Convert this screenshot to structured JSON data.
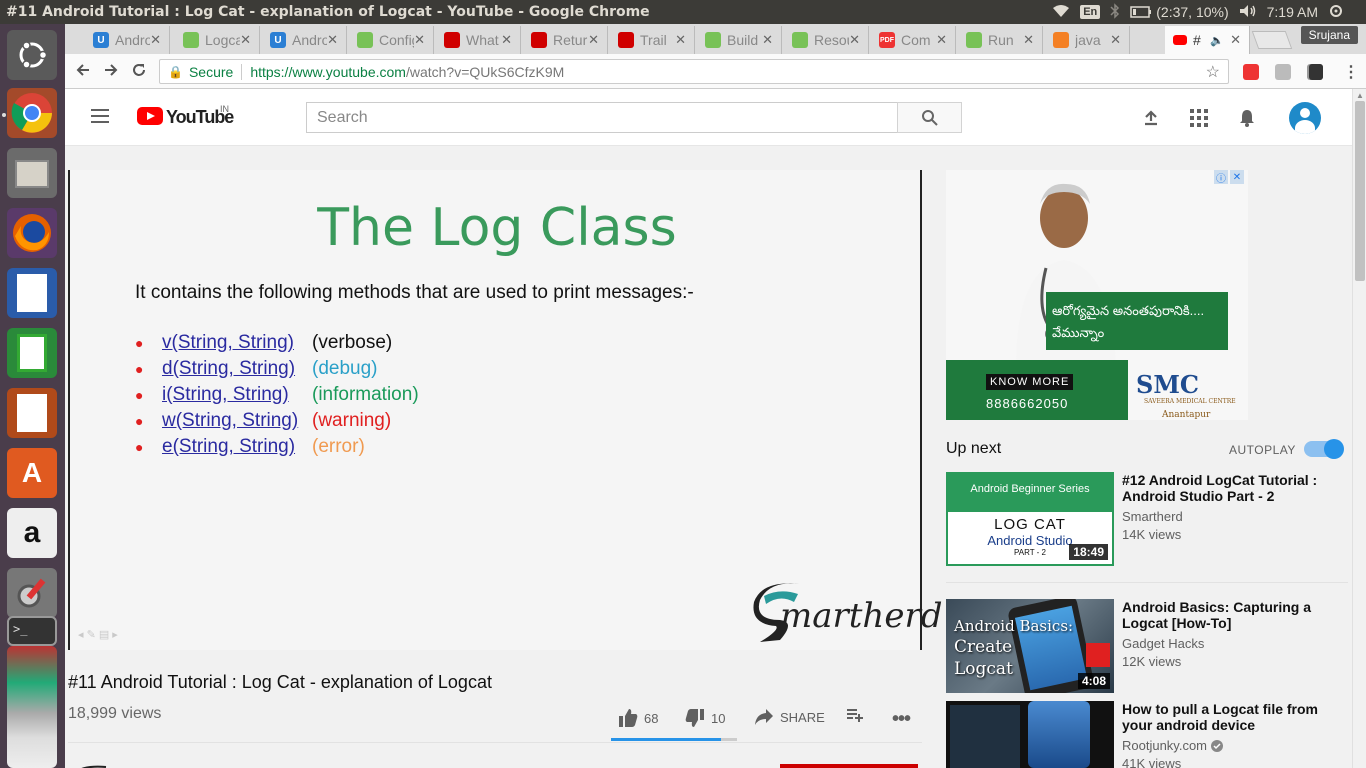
{
  "window_title": "#11 Android Tutorial : Log Cat - explanation of Logcat - YouTube - Google Chrome",
  "topbar": {
    "lang": "En",
    "battery": "(2:37, 10%)",
    "time": "7:19 AM"
  },
  "launcher_icons": [
    "ubuntu-icon",
    "chrome-icon",
    "files-icon",
    "firefox-icon",
    "writer-icon",
    "calc-icon",
    "impress-icon",
    "software-center-icon",
    "amazon-icon",
    "settings-icon",
    "terminal-icon"
  ],
  "tabs": [
    {
      "label": "Android",
      "icon": "udemy",
      "color": "#2b7fd4"
    },
    {
      "label": "Logcat",
      "icon": "android",
      "color": "#78c257"
    },
    {
      "label": "Android",
      "icon": "udemy",
      "color": "#2b7fd4"
    },
    {
      "label": "Config",
      "icon": "android",
      "color": "#78c257"
    },
    {
      "label": "What",
      "icon": "oracle",
      "color": "#d00000"
    },
    {
      "label": "Return",
      "icon": "oracle",
      "color": "#d00000"
    },
    {
      "label": "Trail",
      "icon": "oracle",
      "color": "#d00000"
    },
    {
      "label": "Build",
      "icon": "android",
      "color": "#78c257"
    },
    {
      "label": "Resources",
      "icon": "android",
      "color": "#78c257"
    },
    {
      "label": "Com",
      "icon": "pdf",
      "color": "#e33"
    },
    {
      "label": "Run",
      "icon": "android",
      "color": "#78c257"
    },
    {
      "label": "java",
      "icon": "stackoverflow",
      "color": "#f48024"
    },
    {
      "label": "#",
      "icon": "youtube",
      "color": "#f00"
    }
  ],
  "profile_name": "Srujana",
  "omnibox": {
    "secure_label": "Secure",
    "url_host": "https://www.youtube.com",
    "url_path": "/watch?v=QUkS6CfzK9M"
  },
  "youtube": {
    "logo_text": "YouTube",
    "country": "IN",
    "search_placeholder": "Search"
  },
  "slide": {
    "title": "The Log Class",
    "intro": "It contains the following methods that are used to print messages:-",
    "methods": [
      {
        "method": "v(String, String)",
        "desc": "(verbose)",
        "color": "#111111"
      },
      {
        "method": "d(String, String)",
        "desc": "(debug)",
        "color": "#2aa0c8"
      },
      {
        "method": "i(String, String)",
        "desc": "(information)",
        "color": "#1a9a5a"
      },
      {
        "method": "w(String, String)",
        "desc": "(warning)",
        "color": "#e02020"
      },
      {
        "method": "e(String, String)",
        "desc": "(error)",
        "color": "#f09a50"
      }
    ],
    "brand": "martherd"
  },
  "video": {
    "title": "#11 Android Tutorial : Log Cat - explanation of Logcat",
    "views": "18,999 views",
    "likes": "68",
    "dislikes": "10",
    "share": "SHARE",
    "like_fraction": 0.87
  },
  "ad": {
    "telugu_text": "ఆరోగ్యమైన అనంతపురానికి....",
    "telugu_text2": "వేమున్నాం",
    "know_more": "KNOW MORE",
    "phone": "8886662050",
    "brand": "SMC",
    "brand_sub": "SAVEERA MEDICAL CENTRE",
    "city": "Anantapur"
  },
  "sidebar": {
    "up_next": "Up next",
    "autoplay": "AUTOPLAY",
    "recs": [
      {
        "title": "#12 Android LogCat Tutorial : Android Studio Part - 2",
        "channel": "Smartherd",
        "views": "14K views",
        "duration": "18:49",
        "thumb_series": "Android Beginner Series",
        "thumb_line1": "LOG CAT",
        "thumb_line2": "Android Studio",
        "thumb_line3": "PART - 2"
      },
      {
        "title": "Android Basics: Capturing a Logcat [How-To]",
        "channel": "Gadget Hacks",
        "views": "12K views",
        "duration": "4:08",
        "thumb_line1": "Android Basics:",
        "thumb_line2": "Create",
        "thumb_line3": "Logcat"
      },
      {
        "title": "How to pull a Logcat file from your android device",
        "channel": "Rootjunky.com",
        "views": "41K views",
        "verified": true
      }
    ]
  }
}
